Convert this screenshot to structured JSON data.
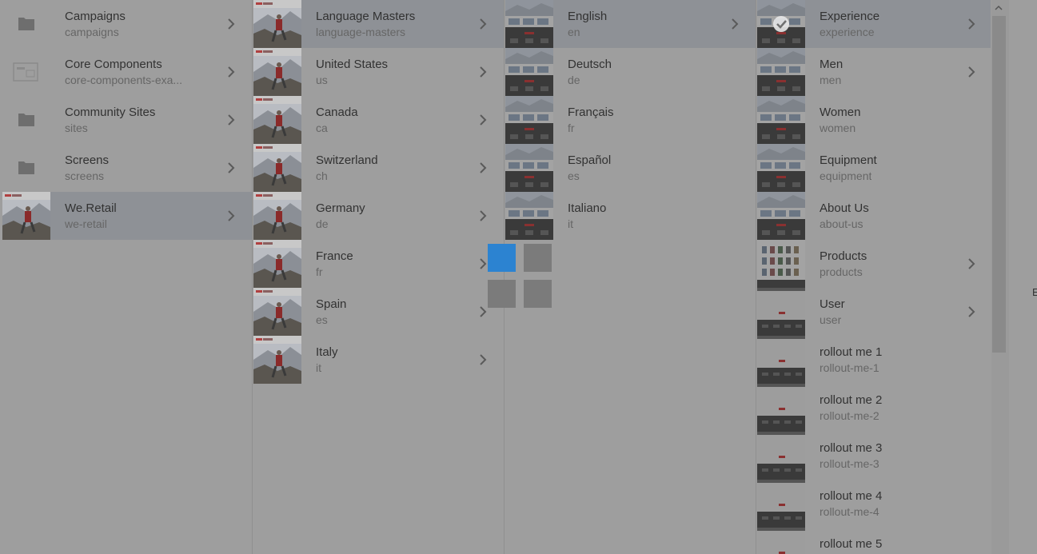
{
  "columns": [
    {
      "items": [
        {
          "title": "Campaigns",
          "name": "campaigns",
          "icon": "folder-icon",
          "chevron": true
        },
        {
          "title": "Core Components",
          "name": "core-components-exa...",
          "icon": "component-icon",
          "chevron": true
        },
        {
          "title": "Community Sites",
          "name": "sites",
          "icon": "folder-icon",
          "chevron": true
        },
        {
          "title": "Screens",
          "name": "screens",
          "icon": "folder-icon",
          "chevron": true
        },
        {
          "title": "We.Retail",
          "name": "we-retail",
          "icon": "site-thumbnail",
          "chevron": true,
          "selected": true
        }
      ]
    },
    {
      "items": [
        {
          "title": "Language Masters",
          "name": "language-masters",
          "chevron": true,
          "selected": true
        },
        {
          "title": "United States",
          "name": "us",
          "chevron": true
        },
        {
          "title": "Canada",
          "name": "ca",
          "chevron": true
        },
        {
          "title": "Switzerland",
          "name": "ch",
          "chevron": true
        },
        {
          "title": "Germany",
          "name": "de",
          "chevron": true
        },
        {
          "title": "France",
          "name": "fr",
          "chevron": true
        },
        {
          "title": "Spain",
          "name": "es",
          "chevron": true
        },
        {
          "title": "Italy",
          "name": "it",
          "chevron": true
        }
      ]
    },
    {
      "items": [
        {
          "title": "English",
          "name": "en",
          "chevron": true,
          "selected": true
        },
        {
          "title": "Deutsch",
          "name": "de"
        },
        {
          "title": "Français",
          "name": "fr"
        },
        {
          "title": "Español",
          "name": "es"
        },
        {
          "title": "Italiano",
          "name": "it"
        }
      ]
    },
    {
      "items": [
        {
          "title": "Experience",
          "name": "experience",
          "chevron": true,
          "selected": true,
          "checked": true
        },
        {
          "title": "Men",
          "name": "men",
          "chevron": true
        },
        {
          "title": "Women",
          "name": "women"
        },
        {
          "title": "Equipment",
          "name": "equipment"
        },
        {
          "title": "About Us",
          "name": "about-us"
        },
        {
          "title": "Products",
          "name": "products",
          "chevron": true
        },
        {
          "title": "User",
          "name": "user",
          "chevron": true
        },
        {
          "title": "rollout me 1",
          "name": "rollout-me-1"
        },
        {
          "title": "rollout me 2",
          "name": "rollout-me-2"
        },
        {
          "title": "rollout me 3",
          "name": "rollout-me-3"
        },
        {
          "title": "rollout me 4",
          "name": "rollout-me-4"
        },
        {
          "title": "rollout me 5",
          "name": "rollout-me-5"
        }
      ]
    }
  ],
  "edge_text": "E",
  "colors": {
    "overlay": "#9e9e9e",
    "selected_row": "#8e9196",
    "loader_accent": "#2c83d1"
  }
}
